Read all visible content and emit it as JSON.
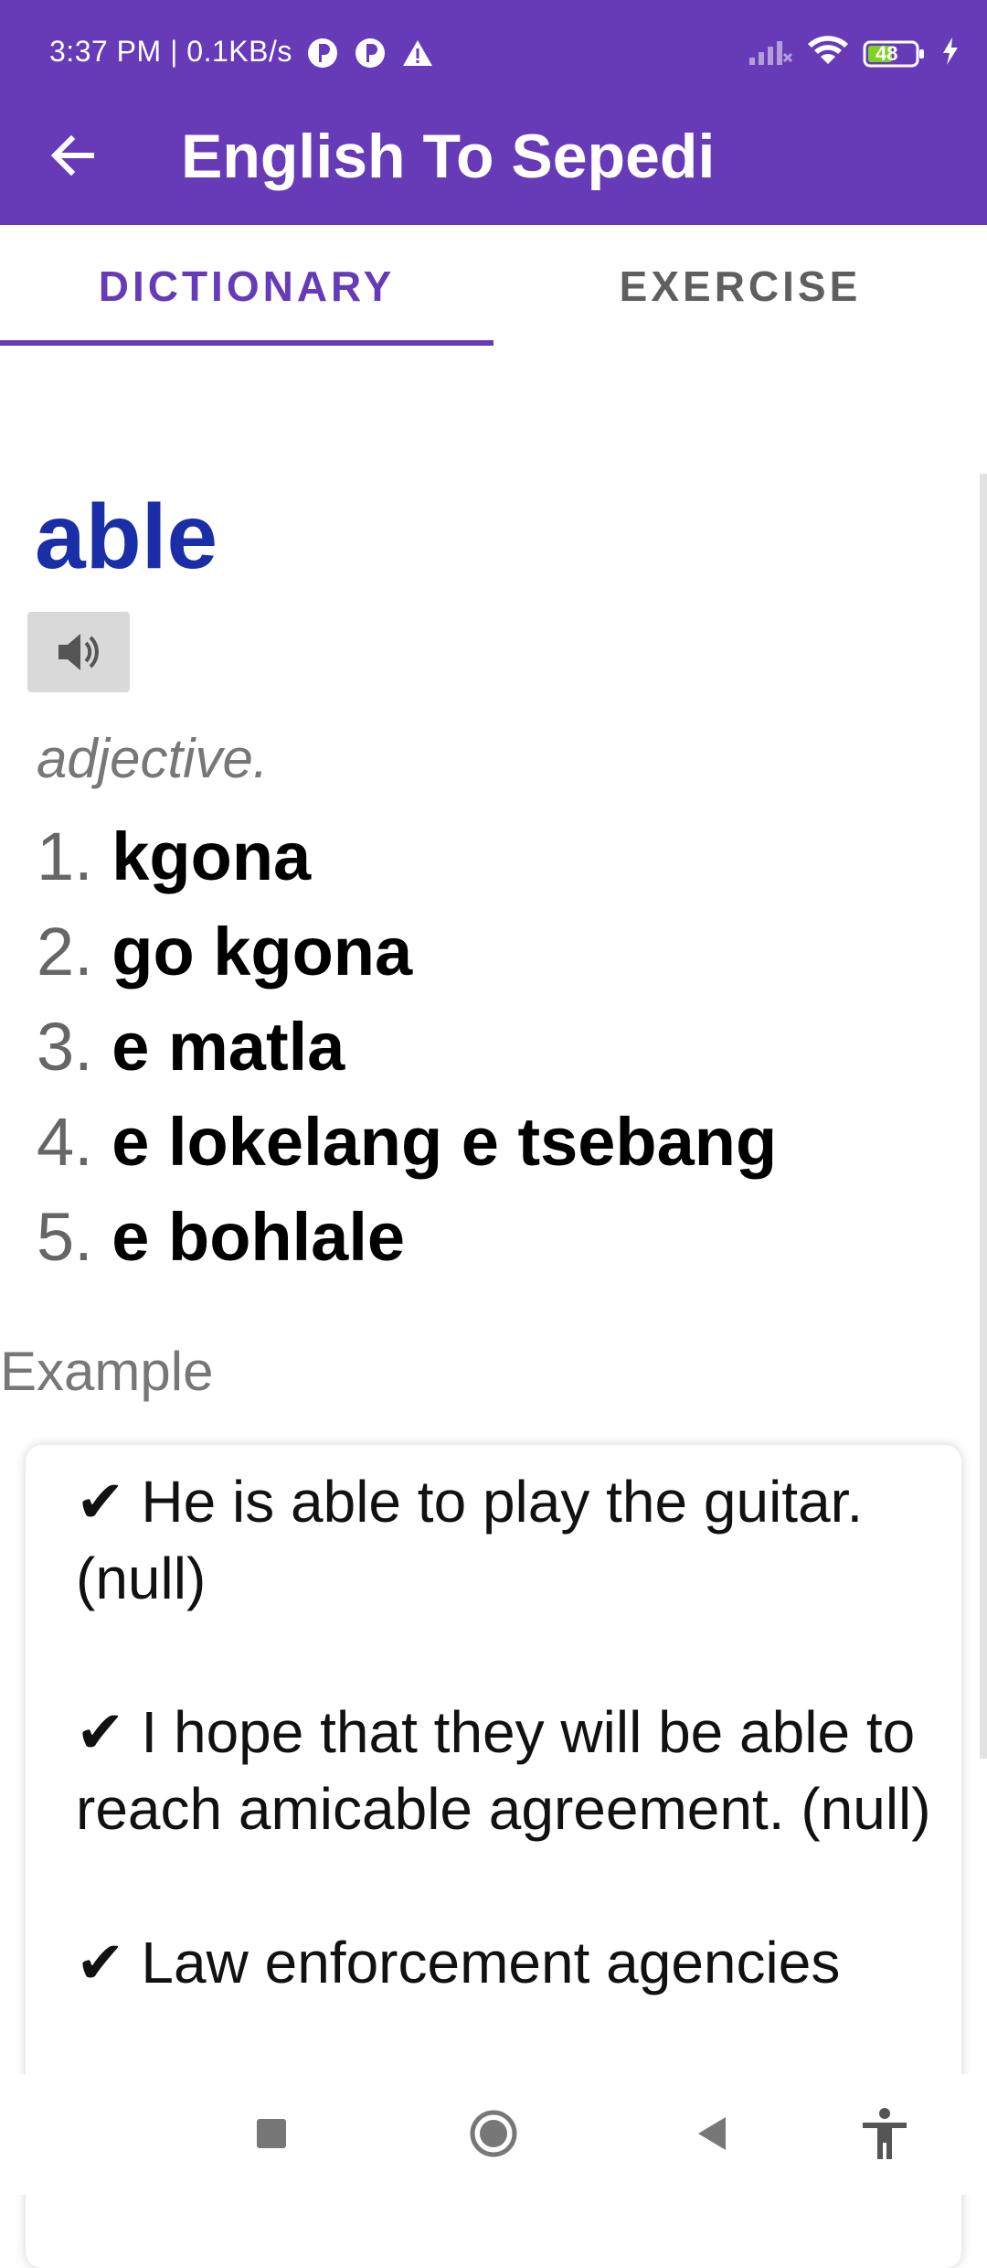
{
  "status_bar": {
    "time_speed": "3:37 PM | 0.1KB/s",
    "battery_level": "48"
  },
  "app_bar": {
    "title": "English To Sepedi"
  },
  "tabs": [
    {
      "label": "DICTIONARY",
      "active": true
    },
    {
      "label": "EXERCISE",
      "active": false
    }
  ],
  "entry": {
    "word": "able",
    "part_of_speech": "adjective.",
    "definitions": [
      {
        "num": "1.",
        "text": "kgona"
      },
      {
        "num": "2.",
        "text": "go kgona"
      },
      {
        "num": "3.",
        "text": "e matla"
      },
      {
        "num": "4.",
        "text": "e lokelang e tsebang"
      },
      {
        "num": "5.",
        "text": "e bohlale"
      }
    ]
  },
  "example": {
    "label": "Example",
    "items": [
      "✔ He is able to play the guitar. (null)",
      "✔ I hope that they will be able to reach amicable agreement. (null)",
      "✔ Law enforcement agencies"
    ]
  },
  "colors": {
    "primary": "#673ab7",
    "word": "#1a2ea8"
  },
  "icons": {
    "back": "arrow-left-icon",
    "speaker": "speaker-icon",
    "nav_recent": "square-icon",
    "nav_home": "circle-icon",
    "nav_back": "triangle-back-icon",
    "nav_accessibility": "accessibility-icon"
  }
}
